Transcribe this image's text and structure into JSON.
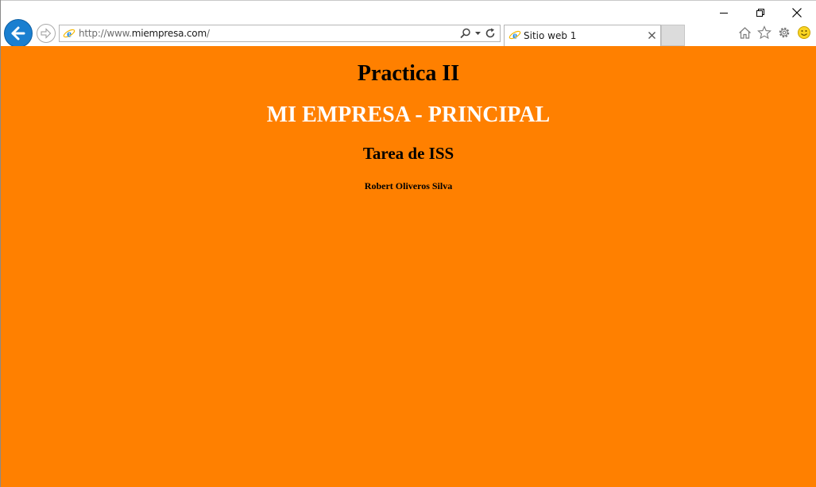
{
  "browser": {
    "window_controls": {
      "minimize": "minimize-icon",
      "restore": "restore-icon",
      "close": "close-icon"
    },
    "address_bar": {
      "url_prefix": "http://www.",
      "url_domain": "miempresa.com",
      "url_suffix": "/"
    },
    "tab": {
      "title": "Sitio web 1"
    },
    "accent_color": "#1a7fd0"
  },
  "page": {
    "background_color": "#ff8000",
    "title": "Practica II",
    "heading": "MI EMPRESA - PRINCIPAL",
    "subheading": "Tarea de ISS",
    "author": "Robert Oliveros Silva"
  }
}
